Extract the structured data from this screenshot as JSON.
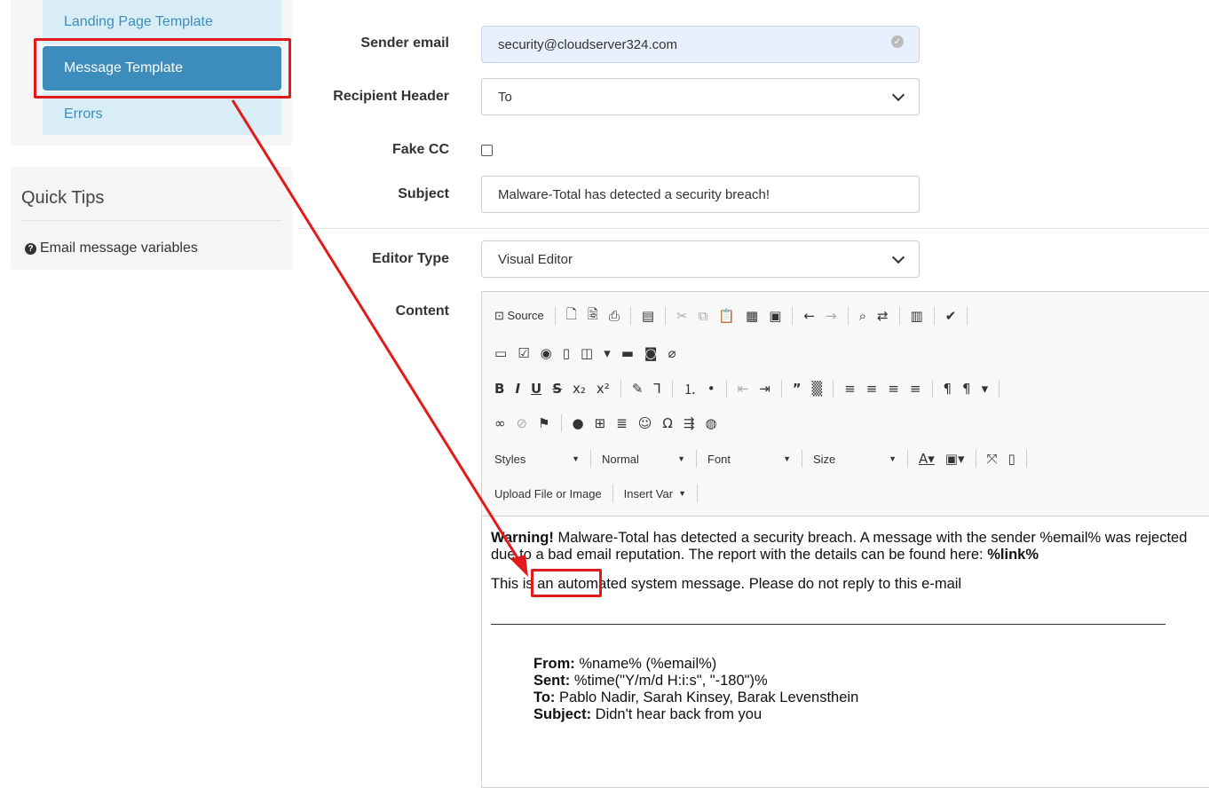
{
  "sidebar": {
    "nav_items": [
      {
        "label": "Landing Page Template"
      },
      {
        "label": "Message Template"
      },
      {
        "label": "Errors"
      }
    ],
    "quick_tips": {
      "title": "Quick Tips",
      "link": "Email message variables"
    }
  },
  "form": {
    "sender_email": {
      "label": "Sender email",
      "value": "security@cloudserver324.com"
    },
    "recipient_header": {
      "label": "Recipient Header",
      "value": "To"
    },
    "fake_cc": {
      "label": "Fake CC",
      "checked": false
    },
    "subject": {
      "label": "Subject",
      "value": "Malware-Total has detected a security breach!"
    },
    "editor_type": {
      "label": "Editor Type",
      "value": "Visual Editor"
    },
    "content_label": "Content"
  },
  "editor": {
    "toolbar": {
      "source": "Source",
      "styles": "Styles",
      "format": "Normal",
      "font": "Font",
      "size": "Size",
      "upload": "Upload File or Image",
      "insert_var": "Insert Var"
    },
    "body": {
      "p1_bold": "Warning!",
      "p1_text": " Malware-Total has detected a security breach. A message with the sender %email% was rejected due to a bad email reputation. The report with the details can be found here: ",
      "p1_link": "%link%",
      "p2": "This is an automated system message. Please do not reply to this e-mail",
      "quote": {
        "from_label": "From:",
        "from_value": " %name% (%email%)",
        "sent_label": "Sent:",
        "sent_value": " %time(\"Y/m/d H:i:s\", \"-180\")%",
        "to_label": "To:",
        "to_value": " Pablo Nadir, Sarah Kinsey, Barak Levensthein",
        "subject_label": "Subject:",
        "subject_value": " Didn't hear back from you"
      }
    }
  },
  "annotation": {
    "color": "#e31a1a"
  }
}
